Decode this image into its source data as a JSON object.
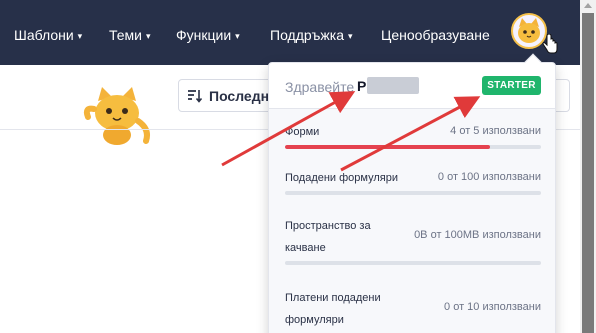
{
  "nav": {
    "items": [
      {
        "label": "Шаблони",
        "caret": "▾"
      },
      {
        "label": "Теми",
        "caret": "▾"
      },
      {
        "label": "Функции",
        "caret": "▾"
      },
      {
        "label": "Поддръжка",
        "caret": "▾"
      },
      {
        "label": "Ценообразуване",
        "caret": ""
      }
    ]
  },
  "toolbar": {
    "sort_label": "Последна"
  },
  "account": {
    "greeting": "Здравейте",
    "username_initial": "P",
    "plan_badge": "STARTER",
    "badge_color": "#1fb56c"
  },
  "usage": [
    {
      "label": "Форми",
      "value": "4 от 5 използвани",
      "fraction": 0.8
    },
    {
      "label": "Подадени формуляри",
      "value": "0 от 100 използвани",
      "fraction": 0
    },
    {
      "label": "Пространство за качване",
      "value": "0B от 100MB използвани",
      "fraction": 0
    },
    {
      "label": "Платени подадени формуляри",
      "value": "0 от 10 използвани",
      "fraction": 0
    }
  ],
  "colors": {
    "nav_bg": "#273049",
    "bar_fill": "#e5424f",
    "arrow": "#e03a3a"
  }
}
